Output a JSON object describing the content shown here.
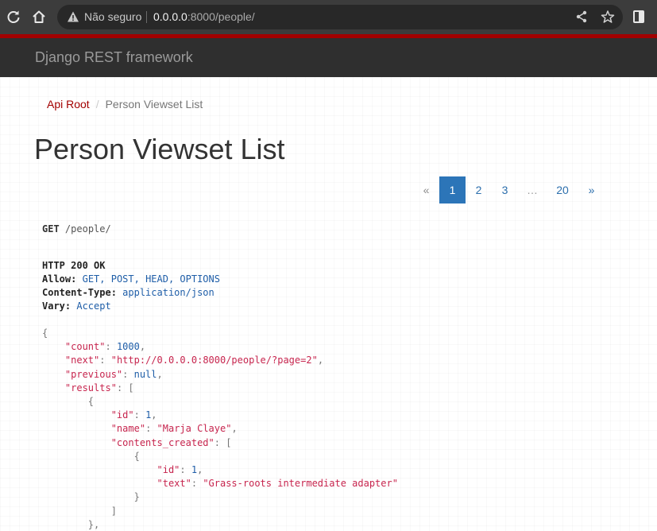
{
  "browser": {
    "not_secure_label": "Não seguro",
    "url_host": "0.0.0.0",
    "url_rest": ":8000/people/",
    "icons": [
      "reload-icon",
      "home-icon",
      "warning-icon",
      "share-icon",
      "star-icon",
      "side-panel-icon"
    ]
  },
  "navbar": {
    "brand": "Django REST framework"
  },
  "breadcrumb": {
    "root": "Api Root",
    "current": "Person Viewset List"
  },
  "page_title": "Person Viewset List",
  "pagination": {
    "prev": "«",
    "pages": [
      "1",
      "2",
      "3"
    ],
    "ellipsis": "…",
    "last": "20",
    "next": "»",
    "active": "1"
  },
  "request": {
    "method": "GET",
    "path": "/people/"
  },
  "response": {
    "status": "HTTP 200 OK",
    "headers": [
      {
        "key": "Allow:",
        "value": "GET, POST, HEAD, OPTIONS"
      },
      {
        "key": "Content-Type:",
        "value": "application/json"
      },
      {
        "key": "Vary:",
        "value": "Accept"
      }
    ]
  },
  "json_body": {
    "count": "1000",
    "next": "\"http://0.0.0.0:8000/people/?page=2\"",
    "previous": "null",
    "first_result": {
      "id": "1",
      "name": "\"Marja Claye\"",
      "content": {
        "id": "1",
        "text": "\"Grass-roots intermediate adapter\""
      }
    }
  },
  "colors": {
    "accent_red": "#a30000",
    "link_blue": "#2c6fad",
    "active_blue": "#2c75b8",
    "navbar": "#2f2f2f"
  }
}
